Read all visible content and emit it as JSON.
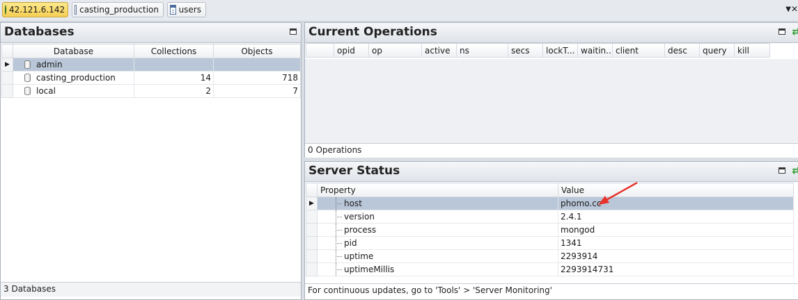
{
  "tabs": [
    {
      "label": "42.121.6.142",
      "icon": "server-globe-icon",
      "active": true
    },
    {
      "label": "casting_production",
      "icon": "database-document-icon",
      "active": false
    },
    {
      "label": "users",
      "icon": "collection-table-icon",
      "active": false
    }
  ],
  "databases": {
    "title": "Databases",
    "columns": [
      "Database",
      "Collections",
      "Objects"
    ],
    "rows": [
      {
        "name": "admin",
        "collections": "",
        "objects": ""
      },
      {
        "name": "casting_production",
        "collections": "14",
        "objects": "718"
      },
      {
        "name": "local",
        "collections": "2",
        "objects": "7"
      }
    ],
    "status": "3 Databases"
  },
  "operations": {
    "title": "Current Operations",
    "columns": [
      "opid",
      "op",
      "active",
      "ns",
      "secs",
      "lockT...",
      "waitin...",
      "client",
      "desc",
      "query",
      "kill"
    ],
    "status": "0 Operations"
  },
  "server_status": {
    "title": "Server Status",
    "columns": [
      "Property",
      "Value"
    ],
    "rows": [
      {
        "property": "host",
        "value": "phomo.cc"
      },
      {
        "property": "version",
        "value": "2.4.1"
      },
      {
        "property": "process",
        "value": "mongod"
      },
      {
        "property": "pid",
        "value": "1341"
      },
      {
        "property": "uptime",
        "value": "2293914"
      },
      {
        "property": "uptimeMillis",
        "value": "2293914731"
      }
    ],
    "status": "For continuous updates, go to 'Tools' > 'Server Monitoring'"
  },
  "colors": {
    "annotation_arrow": "#e8322c",
    "selection": "#b9c7d8",
    "active_tab": "#f6cf54"
  }
}
